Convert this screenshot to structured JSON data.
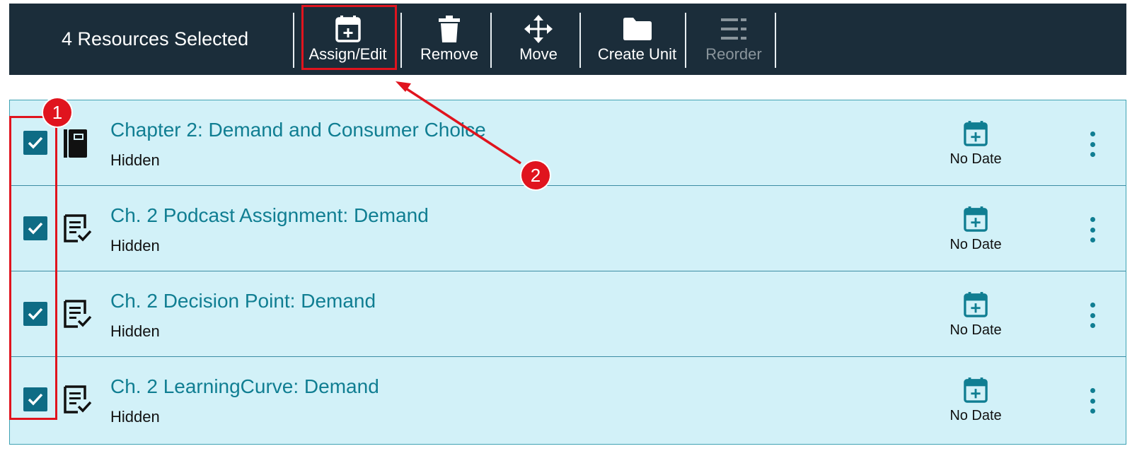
{
  "toolbar": {
    "selected_text": "4 Resources Selected",
    "tools": [
      {
        "label": "Assign/Edit",
        "icon": "calendar-plus-icon",
        "disabled": false
      },
      {
        "label": "Remove",
        "icon": "trash-icon",
        "disabled": false
      },
      {
        "label": "Move",
        "icon": "move-arrows-icon",
        "disabled": false
      },
      {
        "label": "Create Unit",
        "icon": "folder-icon",
        "disabled": false
      },
      {
        "label": "Reorder",
        "icon": "reorder-icon",
        "disabled": true
      }
    ]
  },
  "resources": [
    {
      "title": "Chapter 2: Demand and Consumer Choice",
      "status": "Hidden",
      "date": "No Date",
      "checked": true,
      "icon": "ebook-icon"
    },
    {
      "title": "Ch. 2 Podcast Assignment: Demand",
      "status": "Hidden",
      "date": "No Date",
      "checked": true,
      "icon": "assignment-check-icon"
    },
    {
      "title": "Ch. 2 Decision Point: Demand",
      "status": "Hidden",
      "date": "No Date",
      "checked": true,
      "icon": "assignment-check-icon"
    },
    {
      "title": "Ch. 2 LearningCurve: Demand",
      "status": "Hidden",
      "date": "No Date",
      "checked": true,
      "icon": "assignment-check-icon"
    }
  ],
  "annotations": {
    "badge_1": "1",
    "badge_2": "2"
  },
  "colors": {
    "toolbar_bg": "#1b2d3a",
    "row_bg": "#d2f1f8",
    "accent": "#107e92",
    "checkbox": "#0e6c85",
    "highlight": "#e0141e"
  }
}
